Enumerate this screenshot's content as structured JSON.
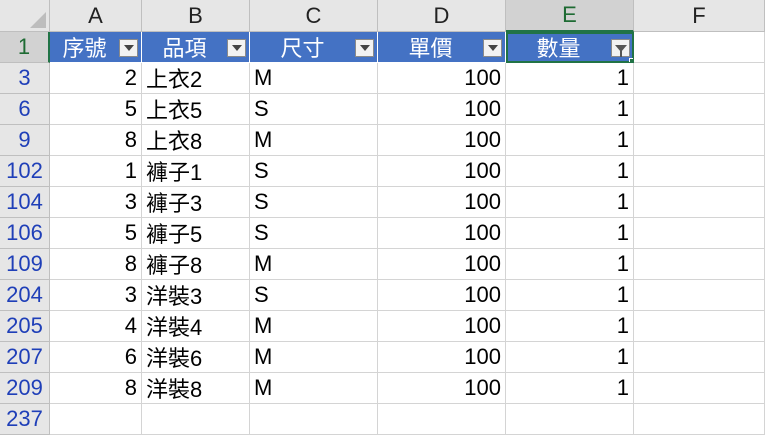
{
  "column_headers": [
    "A",
    "B",
    "C",
    "D",
    "E",
    "F"
  ],
  "header_row": {
    "row_number": "1",
    "labels": [
      "序號",
      "品項",
      "尺寸",
      "單價",
      "數量"
    ]
  },
  "rows": [
    {
      "row": "3",
      "seq": "2",
      "item": "上衣2",
      "size": "M",
      "price": "100",
      "qty": "1"
    },
    {
      "row": "6",
      "seq": "5",
      "item": "上衣5",
      "size": "S",
      "price": "100",
      "qty": "1"
    },
    {
      "row": "9",
      "seq": "8",
      "item": "上衣8",
      "size": "M",
      "price": "100",
      "qty": "1"
    },
    {
      "row": "102",
      "seq": "1",
      "item": "褲子1",
      "size": "S",
      "price": "100",
      "qty": "1"
    },
    {
      "row": "104",
      "seq": "3",
      "item": "褲子3",
      "size": "S",
      "price": "100",
      "qty": "1"
    },
    {
      "row": "106",
      "seq": "5",
      "item": "褲子5",
      "size": "S",
      "price": "100",
      "qty": "1"
    },
    {
      "row": "109",
      "seq": "8",
      "item": "褲子8",
      "size": "M",
      "price": "100",
      "qty": "1"
    },
    {
      "row": "204",
      "seq": "3",
      "item": "洋裝3",
      "size": "S",
      "price": "100",
      "qty": "1"
    },
    {
      "row": "205",
      "seq": "4",
      "item": "洋裝4",
      "size": "M",
      "price": "100",
      "qty": "1"
    },
    {
      "row": "207",
      "seq": "6",
      "item": "洋裝6",
      "size": "M",
      "price": "100",
      "qty": "1"
    },
    {
      "row": "209",
      "seq": "8",
      "item": "洋裝8",
      "size": "M",
      "price": "100",
      "qty": "1"
    }
  ],
  "empty_row": "237",
  "colors": {
    "table_header": "#4472c4",
    "selection": "#217346",
    "row_header_filtered": "#1f3fb8"
  },
  "icons": {
    "corner": "select-all-triangle-icon",
    "dropdown": "filter-dropdown-icon",
    "active_filter": "filter-funnel-icon"
  }
}
